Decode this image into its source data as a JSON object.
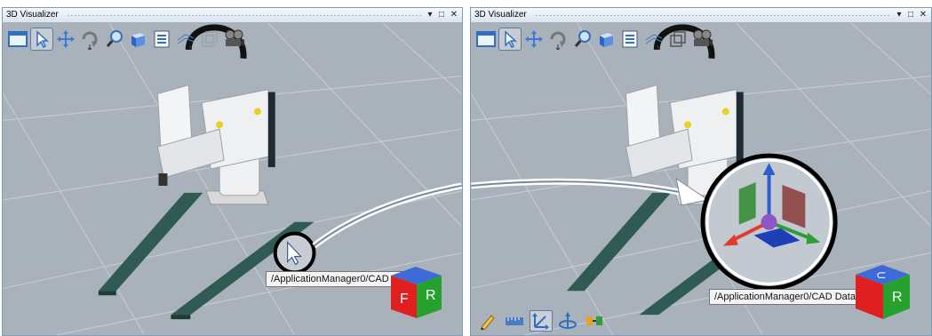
{
  "left_panel": {
    "title": "3D Visualizer",
    "tooltip": "/ApplicationManager0/CAD Data0",
    "toolbar": [
      "window-icon",
      "select-arrow-icon",
      "pan-icon",
      "rotate-icon",
      "zoom-icon",
      "cube-view-icon",
      "properties-icon",
      "grid-icon",
      "wireframe-box-icon",
      "camera-icon"
    ],
    "cube": {
      "front": "F",
      "right": "R"
    }
  },
  "right_panel": {
    "title": "3D Visualizer",
    "tooltip": "/ApplicationManager0/CAD Data0",
    "toolbar": [
      "window-icon",
      "select-arrow-icon",
      "pan-icon",
      "rotate-icon",
      "zoom-icon",
      "cube-view-icon",
      "properties-icon",
      "grid-icon",
      "wireframe-box-icon",
      "camera-icon"
    ],
    "bottom_toolbar": [
      "pencil-icon",
      "measure-icon",
      "move-axis-icon",
      "rotate-axis-icon",
      "snap-icon"
    ],
    "cube": {
      "top": "⊂",
      "right": "R"
    }
  },
  "window_controls": {
    "dropdown": "▾",
    "maximize": "□",
    "close": "✕"
  },
  "colors": {
    "axis_x": "#e23b2e",
    "axis_y": "#2e9d3a",
    "axis_z": "#2c5fcc",
    "center": "#8d57c7",
    "conveyor": "#2f5b52",
    "floor": "#a9b1bb"
  }
}
